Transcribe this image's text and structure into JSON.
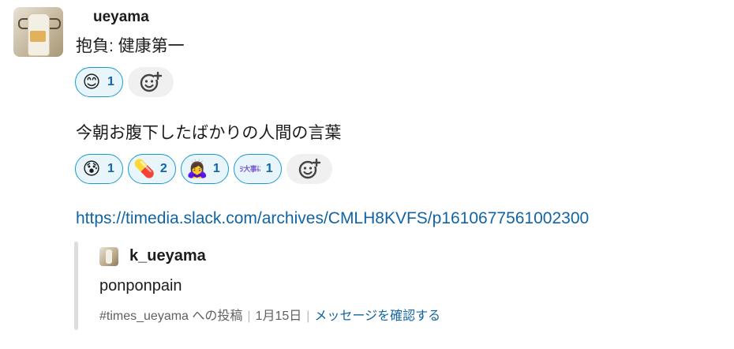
{
  "message": {
    "username": "ueyama",
    "line1": "抱負: 健康第一",
    "line2": "今朝お腹下したばかりの人間の言葉",
    "link": "https://timedia.slack.com/archives/CMLH8KVFS/p1610677561002300"
  },
  "reactions_row1": [
    {
      "emoji": "😊",
      "icon": "smiling-face",
      "count": "1"
    }
  ],
  "reactions_row2": [
    {
      "emoji": "😰",
      "icon": "anxious-face-with-sweat",
      "count": "1"
    },
    {
      "emoji": "💊",
      "icon": "pill",
      "count": "2"
    },
    {
      "emoji": "🙇‍♀️",
      "icon": "woman-bowing",
      "count": "1"
    },
    {
      "emoji": "お大事に",
      "icon": "odaijini-custom-emoji",
      "count": "1"
    }
  ],
  "quote": {
    "username": "k_ueyama",
    "text": "ponponpain",
    "channel": "#times_ueyama への投稿",
    "date": "1月15日",
    "action": "メッセージを確認する"
  },
  "colors": {
    "link": "#1264a3",
    "reaction_border": "#1d9bd1",
    "reaction_bg": "#e8f5fa"
  }
}
